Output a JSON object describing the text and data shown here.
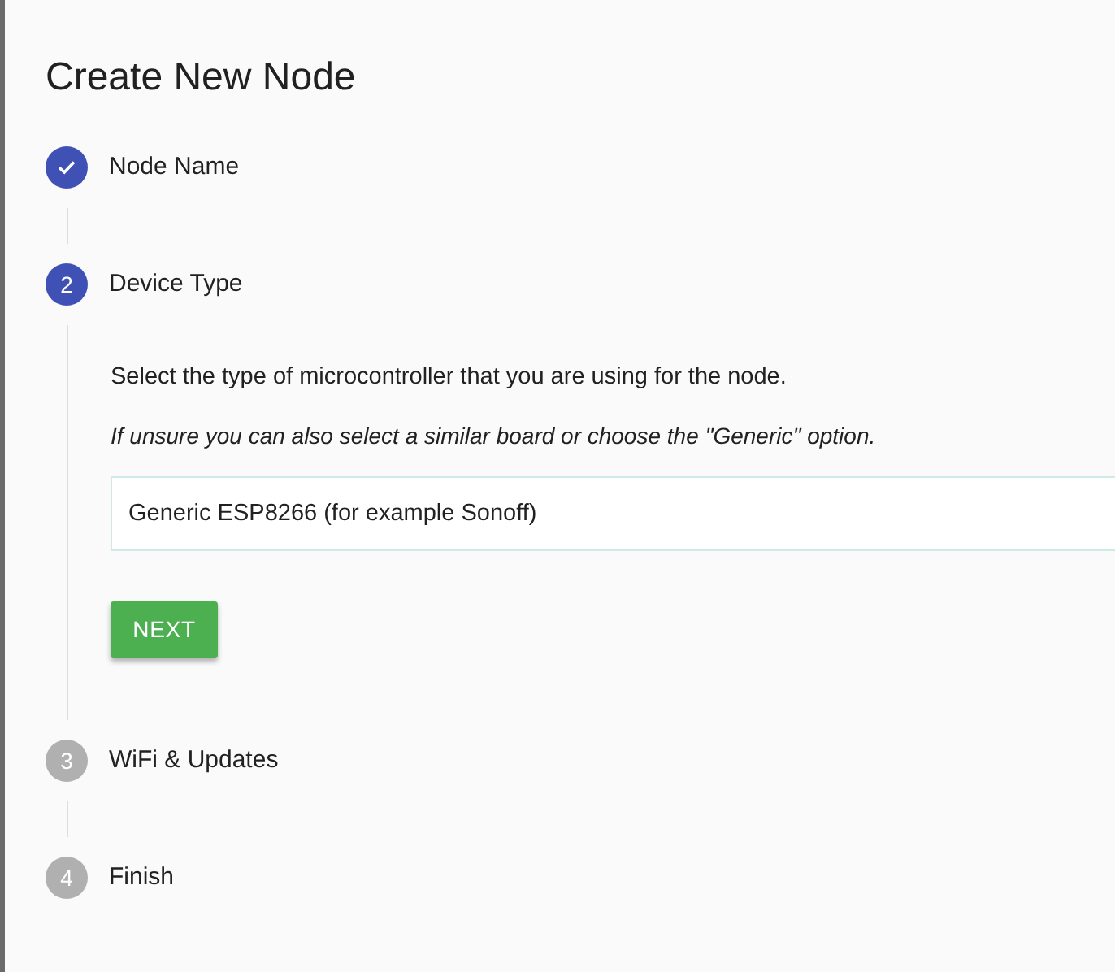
{
  "title": "Create New Node",
  "steps": [
    {
      "label": "Node Name",
      "kind": "done"
    },
    {
      "number": "2",
      "label": "Device Type",
      "kind": "active",
      "content": {
        "instruction": "Select the type of microcontroller that you are using for the node.",
        "hint": "If unsure you can also select a similar board or choose the \"Generic\" option.",
        "field": {
          "value": "Generic ESP8266 (for example Sonoff)"
        },
        "button": "NEXT"
      }
    },
    {
      "number": "3",
      "label": "WiFi & Updates",
      "kind": "pending"
    },
    {
      "number": "4",
      "label": "Finish",
      "kind": "pending"
    }
  ]
}
